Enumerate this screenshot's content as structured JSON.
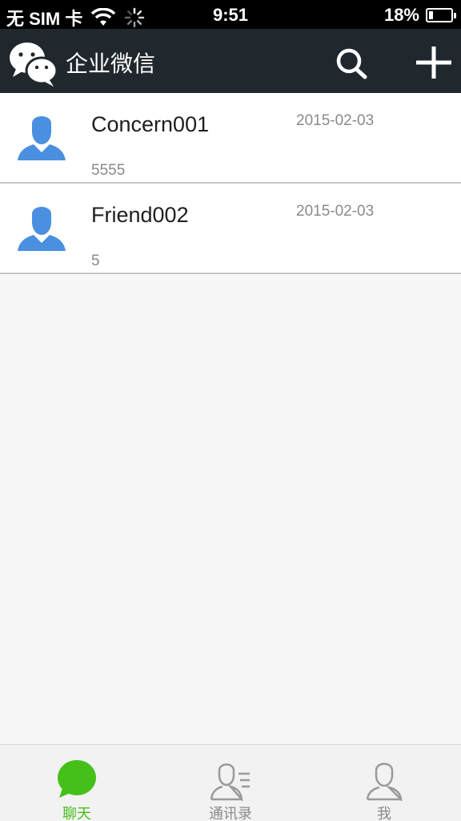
{
  "status_bar": {
    "carrier": "无 SIM 卡",
    "time": "9:51",
    "battery": "18%",
    "battery_level": 0.18
  },
  "header": {
    "title": "企业微信",
    "logo_icon": "wechat-logo-icon",
    "search_icon": "search-icon",
    "add_icon": "plus-icon"
  },
  "chats": [
    {
      "name": "Concern001",
      "date": "2015-02-03",
      "preview": "5555"
    },
    {
      "name": "Friend002",
      "date": "2015-02-03",
      "preview": "5"
    }
  ],
  "tabs": [
    {
      "label": "聊天",
      "icon": "chat-bubble-icon",
      "active": true
    },
    {
      "label": "通讯录",
      "icon": "contacts-icon",
      "active": false
    },
    {
      "label": "我",
      "icon": "person-icon",
      "active": false
    }
  ],
  "colors": {
    "header_bg": "#21282d",
    "accent_green": "#45c01a",
    "avatar_blue": "#4a8fe0"
  }
}
